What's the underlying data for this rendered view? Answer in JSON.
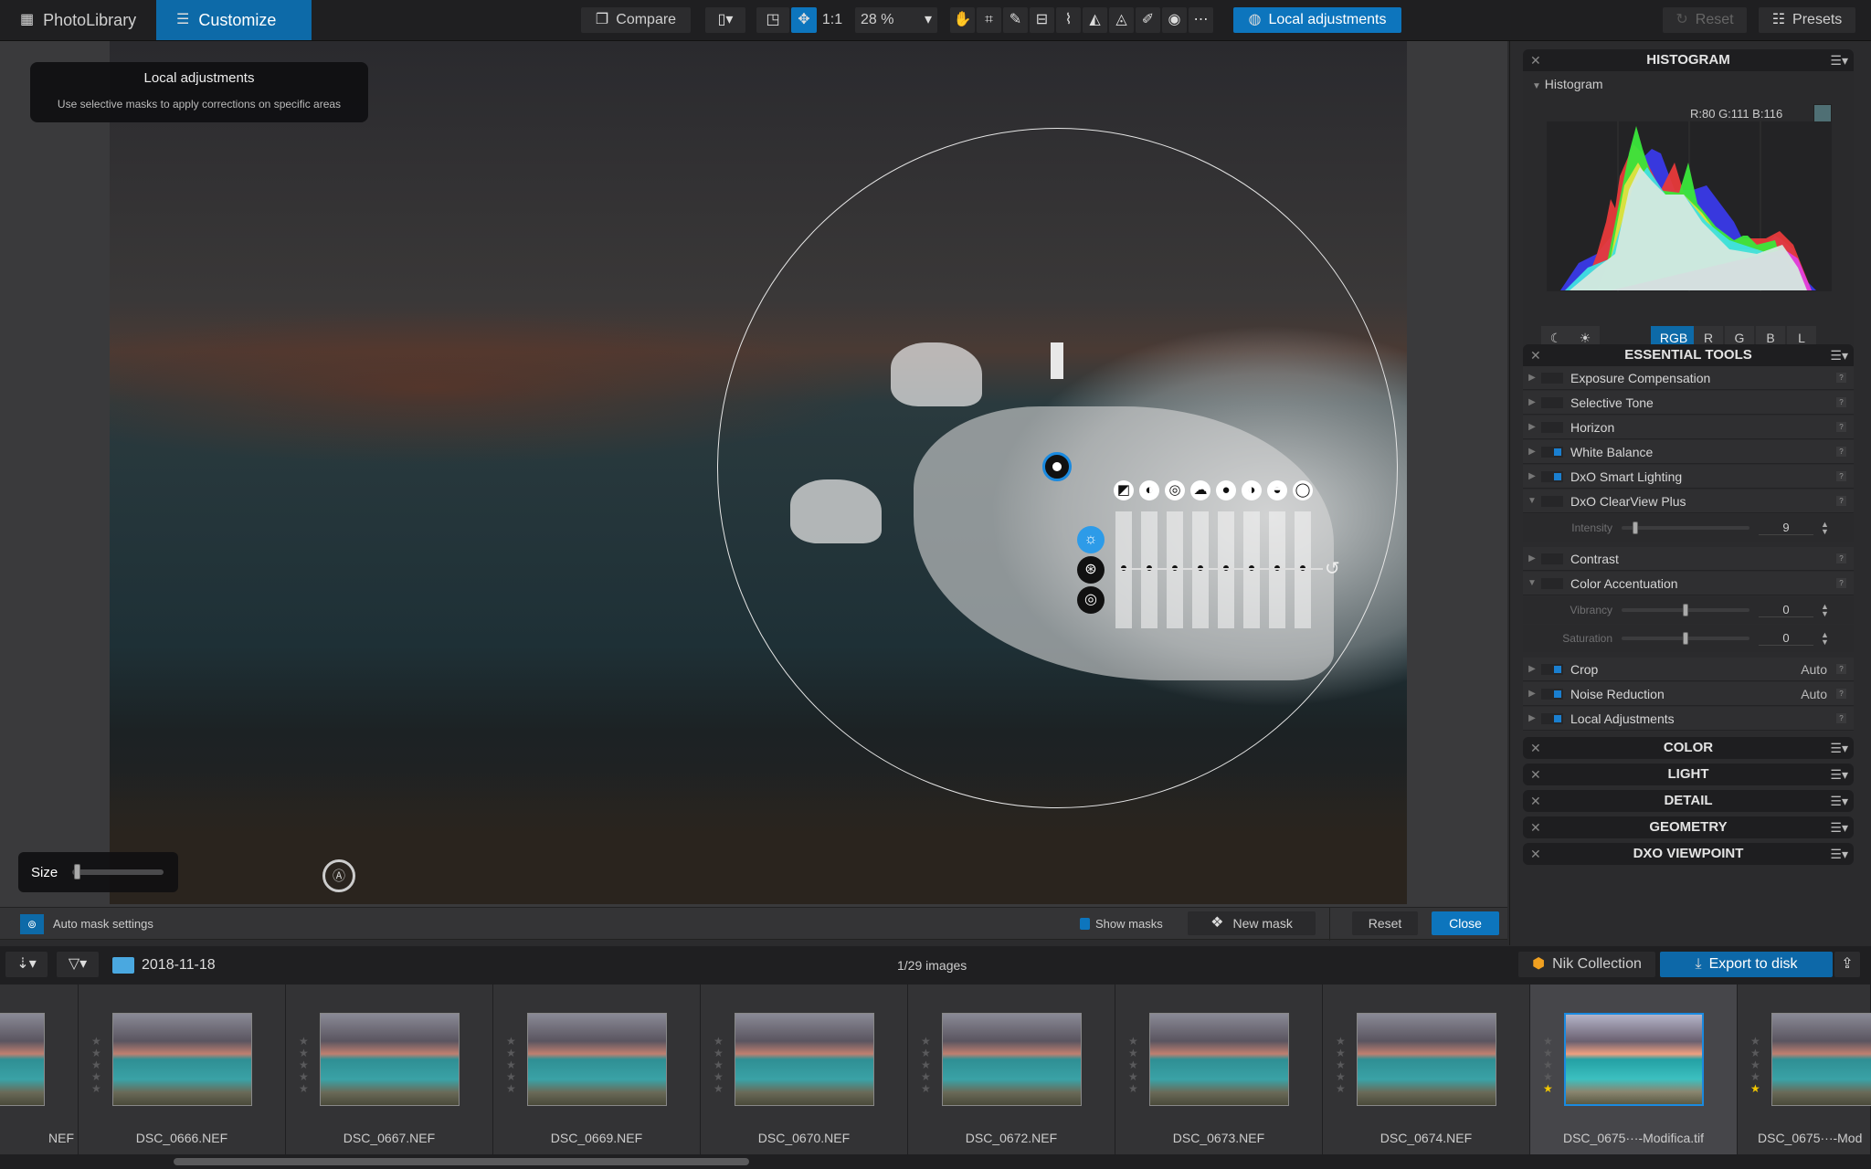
{
  "topbar": {
    "tabs": [
      {
        "label": "PhotoLibrary",
        "icon": "grid-icon"
      },
      {
        "label": "Customize",
        "icon": "sliders-icon",
        "active": true
      }
    ],
    "compare_label": "Compare",
    "one_to_one": "1:1",
    "zoom_value": "28 %",
    "local_adjustments_label": "Local adjustments",
    "reset_label": "Reset",
    "presets_label": "Presets",
    "tools": [
      "hand-icon",
      "crop-icon",
      "eyedropper-icon",
      "straighten-icon",
      "perspective-icon",
      "volume-deformation-icon",
      "distortion-icon",
      "repair-icon",
      "red-eye-icon",
      "moire-icon"
    ]
  },
  "tooltip": {
    "title": "Local adjustments",
    "subtitle": "Use selective masks to apply corrections on specific areas"
  },
  "viewer": {
    "size_label": "Size",
    "size_value_fraction": 0.02
  },
  "equalizer": {
    "icons": [
      "exposure-icon",
      "contrast-icon",
      "microcontrast-icon",
      "clearview-icon",
      "brightness-icon",
      "highlights-icon",
      "midtones-icon",
      "shadows-icon"
    ],
    "mode_icons": [
      "light-mode-icon",
      "color-mode-icon",
      "detail-mode-icon"
    ]
  },
  "maskbar": {
    "auto_mask_label": "Auto mask settings",
    "show_masks_label": "Show masks",
    "show_masks_checked": true,
    "new_mask_label": "New mask",
    "reset_label": "Reset",
    "close_label": "Close"
  },
  "histogram": {
    "header": "HISTOGRAM",
    "section_label": "Histogram",
    "rgb_readout": "R:80 G:111 B:116",
    "swatch_color": "#4f6f74",
    "channels": [
      "RGB",
      "R",
      "G",
      "B",
      "L"
    ],
    "active_channel": "RGB"
  },
  "essential": {
    "header": "ESSENTIAL TOOLS",
    "tools": [
      {
        "label": "Exposure Compensation",
        "on": false,
        "expanded": false
      },
      {
        "label": "Selective Tone",
        "on": false,
        "expanded": false
      },
      {
        "label": "Horizon",
        "on": false,
        "expanded": false
      },
      {
        "label": "White Balance",
        "on": true,
        "expanded": false
      },
      {
        "label": "DxO Smart Lighting",
        "on": true,
        "expanded": false
      },
      {
        "label": "DxO ClearView Plus",
        "on": false,
        "expanded": true,
        "sliders": [
          {
            "label": "Intensity",
            "value": "9",
            "fraction": 0.09
          }
        ]
      },
      {
        "label": "Contrast",
        "on": false,
        "expanded": false
      },
      {
        "label": "Color Accentuation",
        "on": false,
        "expanded": true,
        "sliders": [
          {
            "label": "Vibrancy",
            "value": "0",
            "fraction": 0.5
          },
          {
            "label": "Saturation",
            "value": "0",
            "fraction": 0.5
          }
        ]
      },
      {
        "label": "Crop",
        "on": true,
        "expanded": false,
        "status": "Auto"
      },
      {
        "label": "Noise Reduction",
        "on": true,
        "expanded": false,
        "status": "Auto"
      },
      {
        "label": "Local Adjustments",
        "on": true,
        "expanded": false
      }
    ]
  },
  "palettes": [
    "COLOR",
    "LIGHT",
    "DETAIL",
    "GEOMETRY",
    "DXO VIEWPOINT"
  ],
  "filmbar": {
    "folder": "2018-11-18",
    "count": "1/29 images",
    "nik_label": "Nik Collection",
    "export_label": "Export to disk"
  },
  "filmstrip": [
    {
      "name": "NEF",
      "stars": 0
    },
    {
      "name": "DSC_0666.NEF",
      "stars": 0
    },
    {
      "name": "DSC_0667.NEF",
      "stars": 0
    },
    {
      "name": "DSC_0669.NEF",
      "stars": 0
    },
    {
      "name": "DSC_0670.NEF",
      "stars": 0
    },
    {
      "name": "DSC_0672.NEF",
      "stars": 0
    },
    {
      "name": "DSC_0673.NEF",
      "stars": 0
    },
    {
      "name": "DSC_0674.NEF",
      "stars": 0
    },
    {
      "name": "DSC_0675···-Modifica.tif",
      "stars": 1,
      "selected": true
    },
    {
      "name": "DSC_0675···-Mod",
      "stars": 1
    }
  ],
  "colors": {
    "accent": "#0d75bd",
    "star": "#f3c800"
  }
}
